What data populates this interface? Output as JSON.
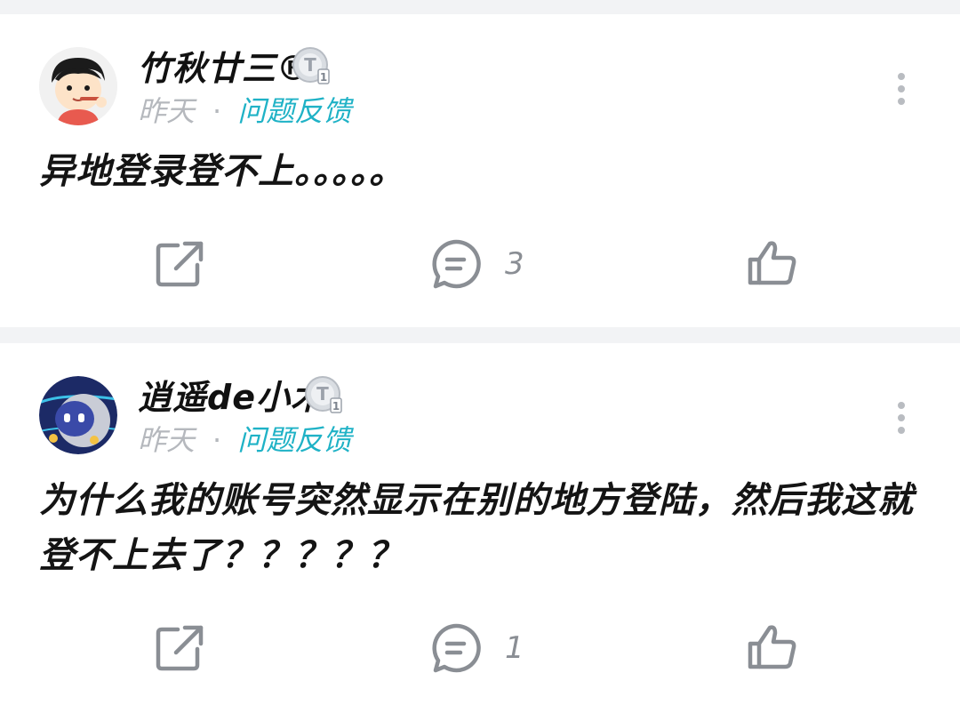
{
  "posts": [
    {
      "username": "竹秋廿三®",
      "time": "昨天",
      "separator": "·",
      "category": "问题反馈",
      "content": "异地登录登不上。。。。。",
      "badge_label": "T",
      "badge_level": "1",
      "comment_count": "3",
      "avatar": "cartoon-boy-avatar"
    },
    {
      "username": "逍遥de小木",
      "time": "昨天",
      "separator": "·",
      "category": "问题反馈",
      "content": "为什么我的账号突然显示在别的地方登陆，然后我这就登不上去了？？？？？",
      "badge_label": "T",
      "badge_level": "1",
      "comment_count": "1",
      "avatar": "robot-avatar"
    }
  ],
  "colors": {
    "category": "#1fb2c6",
    "muted": "#b5b8bd",
    "icon": "#8a8e94",
    "background": "#f2f3f5"
  },
  "icons": [
    "share-icon",
    "comment-icon",
    "like-icon",
    "more-icon",
    "tier-badge-icon"
  ]
}
